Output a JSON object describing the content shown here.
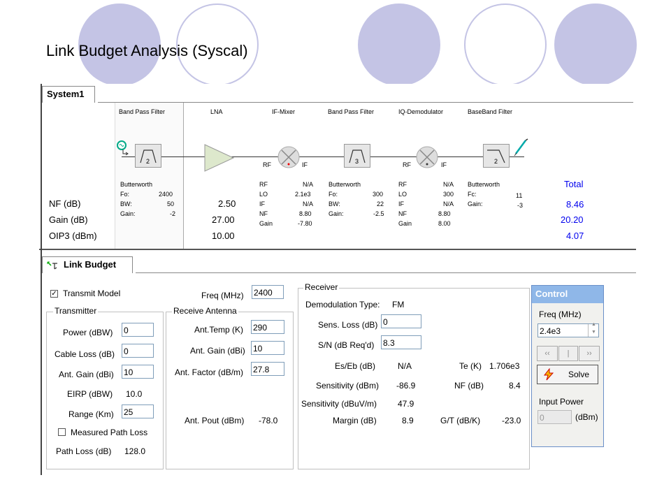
{
  "slide_title": "Link Budget Analysis (Syscal)",
  "system": {
    "tab_label": "System1",
    "components": [
      {
        "name": "Band Pass Filter",
        "badge": "2"
      },
      {
        "name": "LNA"
      },
      {
        "name": "IF-Mixer"
      },
      {
        "name": "Band Pass Filter",
        "badge": "3"
      },
      {
        "name": "IQ-Demodulator"
      },
      {
        "name": "BaseBand Filter",
        "badge": "2"
      }
    ],
    "port_rf": "RF",
    "port_if": "IF",
    "row_labels": [
      "NF (dB)",
      "Gain (dB)",
      "OIP3 (dBm)"
    ],
    "lna_values": [
      "2.50",
      "27.00",
      "10.00"
    ],
    "total_label": "Total",
    "total_values": [
      "8.46",
      "20.20",
      "4.07"
    ],
    "param_blocks": [
      {
        "rows": [
          [
            "Butterworth",
            ""
          ],
          [
            "Fo:",
            "2400"
          ],
          [
            "BW:",
            "50"
          ],
          [
            "Gain:",
            "-2"
          ]
        ]
      },
      {
        "rows": [
          [
            "RF",
            "N/A"
          ],
          [
            "LO",
            "2.1e3"
          ],
          [
            "IF",
            "N/A"
          ],
          [
            "NF",
            "8.80"
          ],
          [
            "Gain",
            "-7.80"
          ]
        ]
      },
      {
        "rows": [
          [
            "Butterworth",
            ""
          ],
          [
            "Fo:",
            "300"
          ],
          [
            "BW:",
            "22"
          ],
          [
            "Gain:",
            "-2.5"
          ]
        ]
      },
      {
        "rows": [
          [
            "RF",
            "N/A"
          ],
          [
            "LO",
            "300"
          ],
          [
            "IF",
            "N/A"
          ],
          [
            "NF",
            "8.80"
          ],
          [
            "Gain",
            "8.00"
          ]
        ]
      },
      {
        "rows": [
          [
            "Butterworth",
            ""
          ],
          [
            "Fc:",
            "11"
          ],
          [
            "Gain:",
            "-3"
          ]
        ]
      }
    ]
  },
  "link_budget": {
    "tab_label": "Link Budget",
    "transmit_model_label": "Transmit Model",
    "transmit_model_checked": true,
    "freq_label": "Freq (MHz)",
    "freq_value": "2400",
    "transmitter": {
      "title": "Transmitter",
      "power_label": "Power (dBW)",
      "power_value": "0",
      "cable_loss_label": "Cable Loss (dB)",
      "cable_loss_value": "0",
      "ant_gain_label": "Ant. Gain (dBi)",
      "ant_gain_value": "10",
      "eirp_label": "EIRP (dBW)",
      "eirp_value": "10.0",
      "range_label": "Range (Km)",
      "range_value": "25",
      "measured_path_loss_label": "Measured Path Loss",
      "measured_path_loss_checked": false,
      "path_loss_label": "Path Loss (dB)",
      "path_loss_value": "128.0"
    },
    "receive_antenna": {
      "title": "Receive Antenna",
      "ant_temp_label": "Ant.Temp (K)",
      "ant_temp_value": "290",
      "ant_gain_label": "Ant. Gain (dBi)",
      "ant_gain_value": "10",
      "ant_factor_label": "Ant. Factor (dB/m)",
      "ant_factor_value": "27.8",
      "ant_pout_label": "Ant. Pout (dBm)",
      "ant_pout_value": "-78.0"
    },
    "receiver": {
      "title": "Receiver",
      "demod_label": "Demodulation Type:",
      "demod_value": "FM",
      "sens_loss_label": "Sens. Loss (dB)",
      "sens_loss_value": "0",
      "sn_label": "S/N (dB Req'd)",
      "sn_value": "8.3",
      "es_eb_label": "Es/Eb (dB)",
      "es_eb_value": "N/A",
      "te_label": "Te (K)",
      "te_value": "1.706e3",
      "sens_dbm_label": "Sensitivity (dBm)",
      "sens_dbm_value": "-86.9",
      "nf_label": "NF (dB)",
      "nf_value": "8.4",
      "sens_dbuv_label": "Sensitivity (dBuV/m)",
      "sens_dbuv_value": "47.9",
      "margin_label": "Margin (dB)",
      "margin_value": "8.9",
      "gt_label": "G/T (dB/K)",
      "gt_value": "-23.0"
    }
  },
  "control": {
    "title": "Control",
    "freq_label": "Freq (MHz)",
    "freq_value": "2.4e3",
    "solve_label": "Solve",
    "input_power_label": "Input Power",
    "input_power_value": "0",
    "input_power_unit": "(dBm)"
  },
  "colors": {
    "accent_purple": "#c4c4e5",
    "control_header": "#8fb7e8",
    "total_blue": "#0000ee"
  }
}
